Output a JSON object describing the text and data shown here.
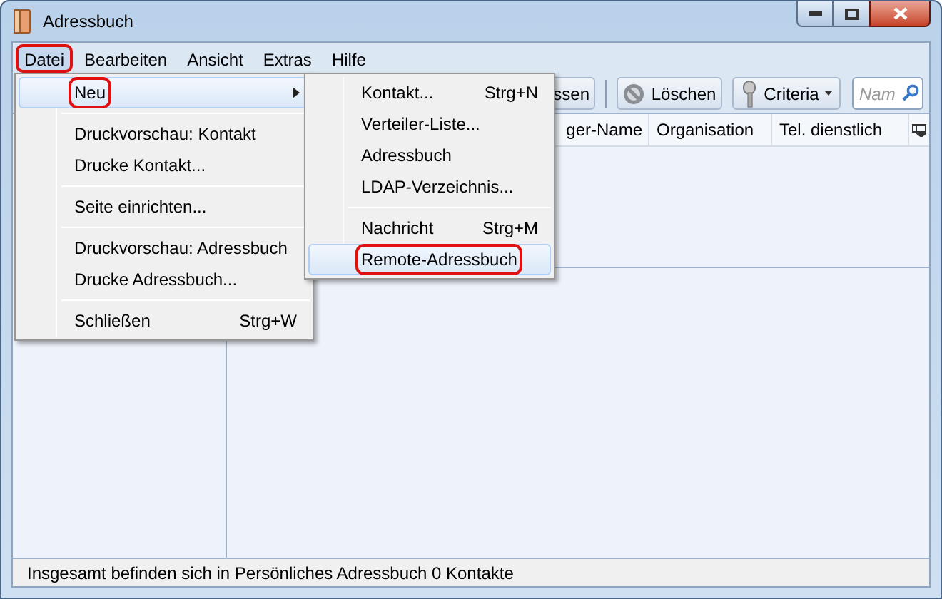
{
  "window": {
    "title": "Adressbuch"
  },
  "menu_bar": [
    {
      "label": "Datei",
      "selected": true,
      "highlighted": true
    },
    {
      "label": "Bearbeiten",
      "selected": false,
      "highlighted": false
    },
    {
      "label": "Ansicht",
      "selected": false,
      "highlighted": false
    },
    {
      "label": "Extras",
      "selected": false,
      "highlighted": false
    },
    {
      "label": "Hilfe",
      "selected": false,
      "highlighted": false
    }
  ],
  "toolbar": {
    "buttons": [
      {
        "label": "ssen",
        "kind": "plain"
      },
      {
        "label": "Löschen",
        "kind": "delete"
      },
      {
        "label": "Criteria",
        "kind": "dropdown"
      }
    ],
    "search": {
      "placeholder": "Nam"
    }
  },
  "table": {
    "columns": [
      "ger-Name",
      "Organisation",
      "Tel. dienstlich"
    ]
  },
  "status_bar": {
    "text": "Insgesamt befinden sich in Persönliches Adressbuch 0 Kontakte"
  },
  "file_menu": {
    "items": [
      {
        "kind": "item",
        "label": "Neu",
        "has_submenu": true,
        "selected": true,
        "highlighted": true
      },
      {
        "kind": "separator"
      },
      {
        "kind": "item",
        "label": "Druckvorschau: Kontakt",
        "selected": false,
        "highlighted": false
      },
      {
        "kind": "item",
        "label": "Drucke Kontakt...",
        "selected": false,
        "highlighted": false
      },
      {
        "kind": "separator"
      },
      {
        "kind": "item",
        "label": "Seite einrichten...",
        "selected": false,
        "highlighted": false
      },
      {
        "kind": "separator"
      },
      {
        "kind": "item",
        "label": "Druckvorschau: Adressbuch",
        "selected": false,
        "highlighted": false
      },
      {
        "kind": "item",
        "label": "Drucke Adressbuch...",
        "selected": false,
        "highlighted": false
      },
      {
        "kind": "separator"
      },
      {
        "kind": "item",
        "label": "Schließen",
        "shortcut": "Strg+W",
        "selected": false,
        "highlighted": false
      }
    ]
  },
  "new_submenu": {
    "items": [
      {
        "kind": "item",
        "label": "Kontakt...",
        "shortcut": "Strg+N",
        "selected": false,
        "highlighted": false
      },
      {
        "kind": "item",
        "label": "Verteiler-Liste...",
        "selected": false,
        "highlighted": false
      },
      {
        "kind": "item",
        "label": "Adressbuch",
        "selected": false,
        "highlighted": false
      },
      {
        "kind": "item",
        "label": "LDAP-Verzeichnis...",
        "selected": false,
        "highlighted": false
      },
      {
        "kind": "separator"
      },
      {
        "kind": "item",
        "label": "Nachricht",
        "shortcut": "Strg+M",
        "selected": false,
        "highlighted": false
      },
      {
        "kind": "item",
        "label": "Remote-Adressbuch",
        "selected": true,
        "highlighted": true
      }
    ]
  }
}
